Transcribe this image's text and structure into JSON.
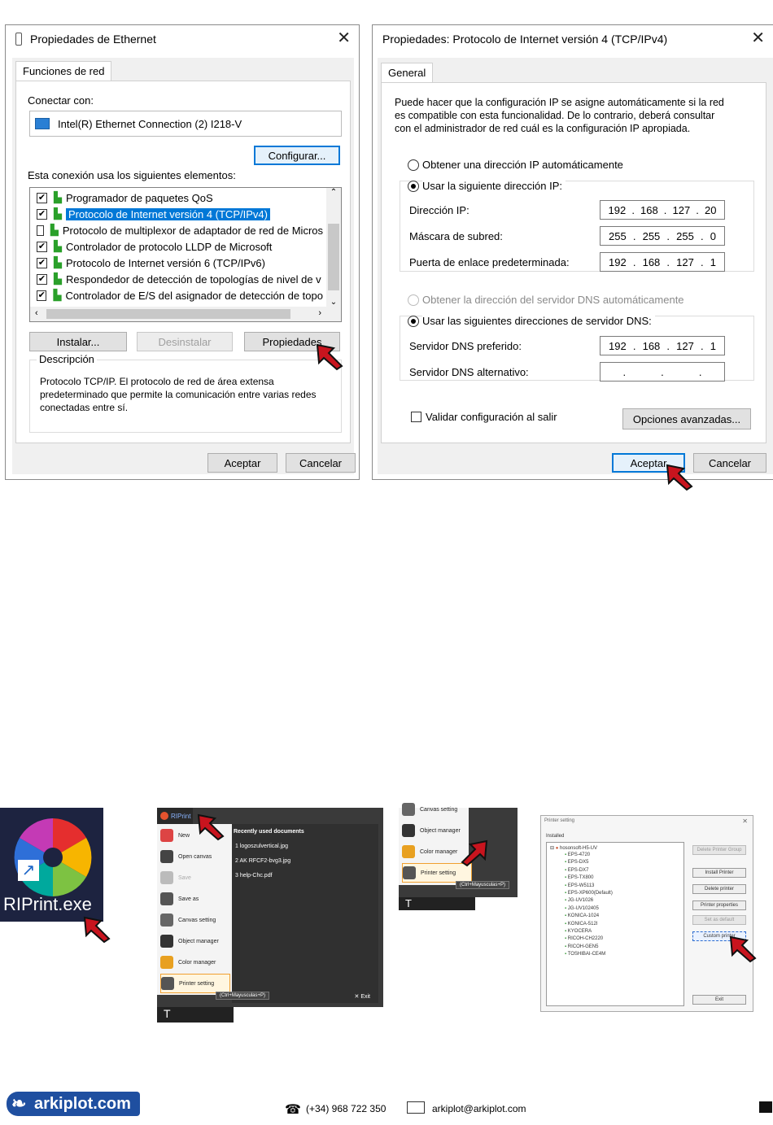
{
  "eth": {
    "title": "Propiedades de Ethernet",
    "tab": "Funciones de red",
    "connect_label": "Conectar con:",
    "adapter": "Intel(R) Ethernet Connection (2) I218-V",
    "configure_btn": "Configurar...",
    "elements_label": "Esta conexión usa los siguientes elementos:",
    "items": [
      {
        "label": "Programador de paquetes QoS",
        "checked": "✔"
      },
      {
        "label": "Protocolo de Internet versión 4 (TCP/IPv4)",
        "checked": "✔"
      },
      {
        "label": "Protocolo de multiplexor de adaptador de red de Micros",
        "checked": ""
      },
      {
        "label": "Controlador de protocolo LLDP de Microsoft",
        "checked": "✔"
      },
      {
        "label": "Protocolo de Internet versión 6 (TCP/IPv6)",
        "checked": "✔"
      },
      {
        "label": "Respondedor de detección de topologías de nivel de v",
        "checked": "✔"
      },
      {
        "label": "Controlador de E/S del asignador de detección de topo",
        "checked": "✔"
      }
    ],
    "install_btn": "Instalar...",
    "uninstall_btn": "Desinstalar",
    "properties_btn": "Propiedades",
    "desc_title": "Descripción",
    "desc_text": "Protocolo TCP/IP. El protocolo de red de área extensa predeterminado que permite la comunicación entre varias redes conectadas entre sí.",
    "ok_btn": "Aceptar",
    "cancel_btn": "Cancelar"
  },
  "ipv4": {
    "title": "Propiedades: Protocolo de Internet versión 4 (TCP/IPv4)",
    "tab": "General",
    "intro": "Puede hacer que la configuración IP se asigne automáticamente si la red es compatible con esta funcionalidad. De lo contrario, deberá consultar con el administrador de red cuál es la configuración IP apropiada.",
    "auto_ip": "Obtener una dirección IP automáticamente",
    "manual_ip": "Usar la siguiente dirección IP:",
    "ip_label": "Dirección IP:",
    "ip": [
      "192",
      "168",
      "127",
      "20"
    ],
    "mask_label": "Máscara de subred:",
    "mask": [
      "255",
      "255",
      "255",
      "0"
    ],
    "gw_label": "Puerta de enlace predeterminada:",
    "gw": [
      "192",
      "168",
      "127",
      "1"
    ],
    "auto_dns": "Obtener la dirección del servidor DNS automáticamente",
    "manual_dns": "Usar las siguientes direcciones de servidor DNS:",
    "dns1_label": "Servidor DNS preferido:",
    "dns1": [
      "192",
      "168",
      "127",
      "1"
    ],
    "dns2_label": "Servidor DNS alternativo:",
    "validate": "Validar configuración al salir",
    "advanced_btn": "Opciones avanzadas...",
    "ok_btn": "Aceptar",
    "cancel_btn": "Cancelar"
  },
  "riprint": {
    "exe_label": "RIPrint.exe",
    "app_name": "RIPrint",
    "menu": [
      "New",
      "Open canvas",
      "Save",
      "Save as",
      "Canvas setting",
      "Object manager",
      "Color manager",
      "Printer setting"
    ],
    "recent_title": "Recently used documents",
    "recent": [
      "1 logoszulvertical.jpg",
      "2 AK RFCF2-bvg3.jpg",
      "3 help-Chc.pdf"
    ],
    "shortcut": "(Ctrl+Mayusculas+P)",
    "exit": "Exit",
    "menu2": [
      "Canvas setting",
      "Object manager",
      "Color manager",
      "Printer setting"
    ]
  },
  "printer_dialog": {
    "title": "Printer setting",
    "installed": "Installed",
    "root": "hosonsoft-H5-UV",
    "printers": [
      "EPS-4720",
      "EPS-DX5",
      "EPS-DX7",
      "EPS-TX800",
      "EPS-W5113",
      "EPS-XP600(Default)",
      "JG-UV1026",
      "JG-UV102405",
      "KONICA-1024",
      "KONICA-512I",
      "KYOCERA",
      "RICOH-CH2220",
      "RICOH-GEN5",
      "TOSHIBAI-CE4M"
    ],
    "buttons": [
      "Delete Printer Group",
      "Install Printer",
      "Delete printer",
      "Printer properties",
      "Set as default",
      "Custom printer"
    ],
    "exit": "Exit"
  },
  "footer": {
    "brand": "arkiplot.com",
    "phone": "(+34) 968 722 350",
    "email": "arkiplot@arkiplot.com"
  }
}
